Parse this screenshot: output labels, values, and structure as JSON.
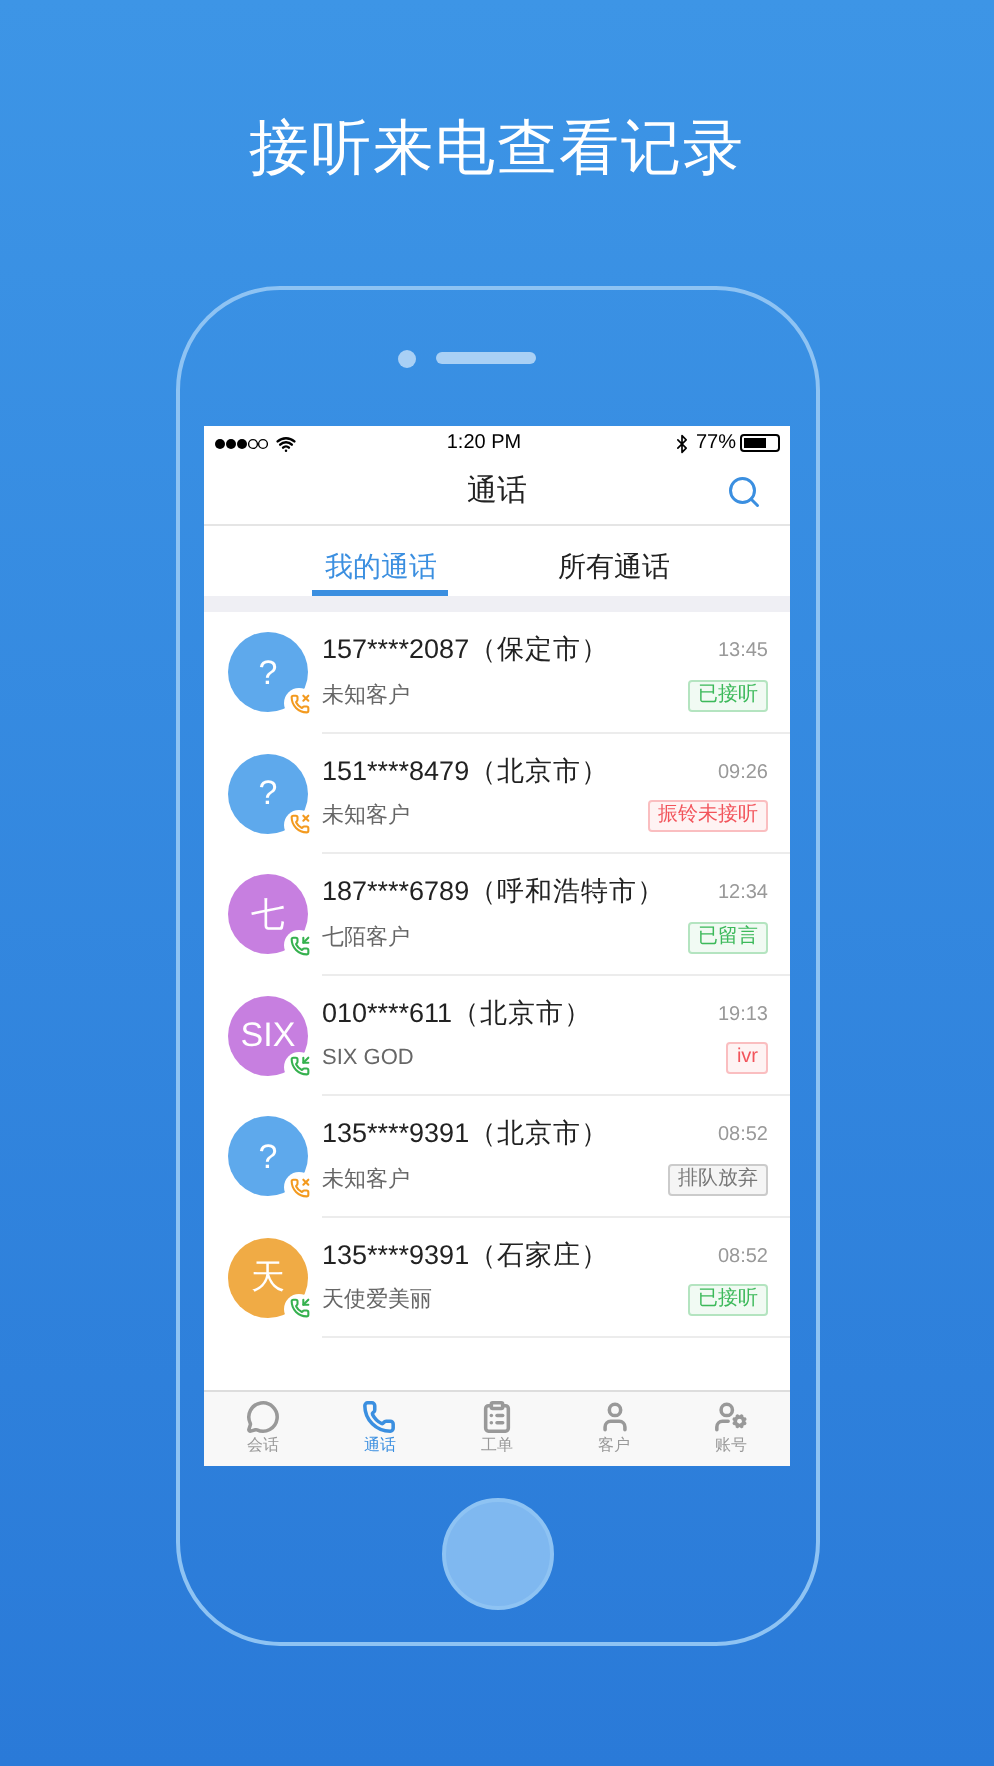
{
  "headline": "接听来电查看记录",
  "status_bar": {
    "time": "1:20 PM",
    "battery": "77%"
  },
  "nav": {
    "title": "通话"
  },
  "tabs": [
    {
      "label": "我的通话",
      "selected": true
    },
    {
      "label": "所有通话",
      "selected": false
    }
  ],
  "calls": [
    {
      "avatar": "?",
      "color": "#5ea9ec",
      "kind": "missed",
      "number": "157****2087（保定市）",
      "name": "未知客户",
      "time": "13:45",
      "status": {
        "text": "已接听",
        "color": "#3cb95a"
      }
    },
    {
      "avatar": "?",
      "color": "#5ea9ec",
      "kind": "missed",
      "number": "151****8479（北京市）",
      "name": "未知客户",
      "time": "09:26",
      "status": {
        "text": "振铃未接听",
        "color": "#f2545b"
      }
    },
    {
      "avatar": "七",
      "color": "#c77fe0",
      "kind": "incoming",
      "number": "187****6789（呼和浩特市）",
      "name": "七陌客户",
      "time": "12:34",
      "status": {
        "text": "已留言",
        "color": "#3cb95a"
      }
    },
    {
      "avatar": "SIX",
      "color": "#c77fe0",
      "kind": "incoming",
      "number": "010****611（北京市）",
      "name": "SIX GOD",
      "time": "19:13",
      "status": {
        "text": "ivr",
        "color": "#f2545b"
      }
    },
    {
      "avatar": "?",
      "color": "#5ea9ec",
      "kind": "missed",
      "number": "135****9391（北京市）",
      "name": "未知客户",
      "time": "08:52",
      "status": {
        "text": "排队放弃",
        "color": "#777777"
      }
    },
    {
      "avatar": "天",
      "color": "#f0ab45",
      "kind": "incoming",
      "number": "135****9391（石家庄）",
      "name": "天使爱美丽",
      "time": "08:52",
      "status": {
        "text": "已接听",
        "color": "#3cb95a"
      }
    }
  ],
  "tab_bar": [
    {
      "label": "会话",
      "kind": "chat",
      "selected": false
    },
    {
      "label": "通话",
      "kind": "phone",
      "selected": true
    },
    {
      "label": "工单",
      "kind": "clipboard",
      "selected": false
    },
    {
      "label": "客户",
      "kind": "person",
      "selected": false
    },
    {
      "label": "账号",
      "kind": "account",
      "selected": false
    }
  ]
}
